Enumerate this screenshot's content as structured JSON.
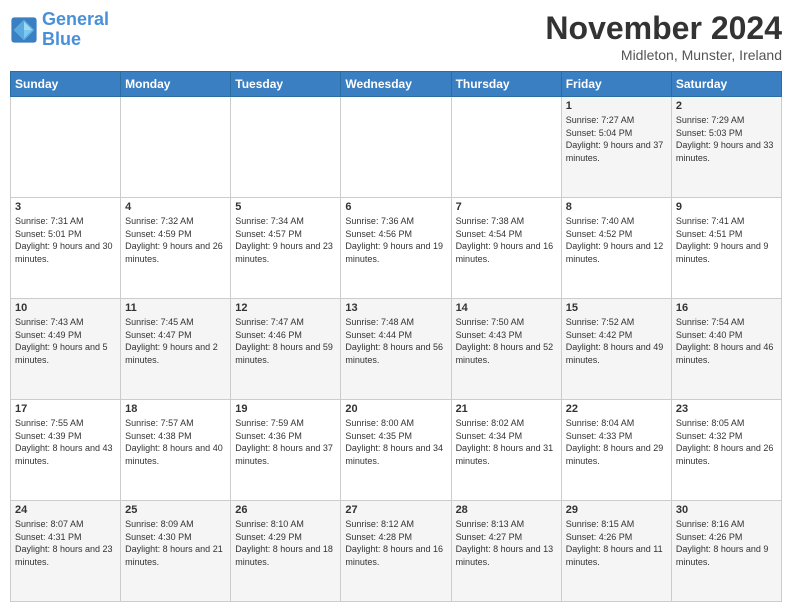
{
  "logo": {
    "line1": "General",
    "line2": "Blue"
  },
  "title": "November 2024",
  "location": "Midleton, Munster, Ireland",
  "days_of_week": [
    "Sunday",
    "Monday",
    "Tuesday",
    "Wednesday",
    "Thursday",
    "Friday",
    "Saturday"
  ],
  "weeks": [
    [
      {
        "day": "",
        "info": ""
      },
      {
        "day": "",
        "info": ""
      },
      {
        "day": "",
        "info": ""
      },
      {
        "day": "",
        "info": ""
      },
      {
        "day": "",
        "info": ""
      },
      {
        "day": "1",
        "info": "Sunrise: 7:27 AM\nSunset: 5:04 PM\nDaylight: 9 hours and 37 minutes."
      },
      {
        "day": "2",
        "info": "Sunrise: 7:29 AM\nSunset: 5:03 PM\nDaylight: 9 hours and 33 minutes."
      }
    ],
    [
      {
        "day": "3",
        "info": "Sunrise: 7:31 AM\nSunset: 5:01 PM\nDaylight: 9 hours and 30 minutes."
      },
      {
        "day": "4",
        "info": "Sunrise: 7:32 AM\nSunset: 4:59 PM\nDaylight: 9 hours and 26 minutes."
      },
      {
        "day": "5",
        "info": "Sunrise: 7:34 AM\nSunset: 4:57 PM\nDaylight: 9 hours and 23 minutes."
      },
      {
        "day": "6",
        "info": "Sunrise: 7:36 AM\nSunset: 4:56 PM\nDaylight: 9 hours and 19 minutes."
      },
      {
        "day": "7",
        "info": "Sunrise: 7:38 AM\nSunset: 4:54 PM\nDaylight: 9 hours and 16 minutes."
      },
      {
        "day": "8",
        "info": "Sunrise: 7:40 AM\nSunset: 4:52 PM\nDaylight: 9 hours and 12 minutes."
      },
      {
        "day": "9",
        "info": "Sunrise: 7:41 AM\nSunset: 4:51 PM\nDaylight: 9 hours and 9 minutes."
      }
    ],
    [
      {
        "day": "10",
        "info": "Sunrise: 7:43 AM\nSunset: 4:49 PM\nDaylight: 9 hours and 5 minutes."
      },
      {
        "day": "11",
        "info": "Sunrise: 7:45 AM\nSunset: 4:47 PM\nDaylight: 9 hours and 2 minutes."
      },
      {
        "day": "12",
        "info": "Sunrise: 7:47 AM\nSunset: 4:46 PM\nDaylight: 8 hours and 59 minutes."
      },
      {
        "day": "13",
        "info": "Sunrise: 7:48 AM\nSunset: 4:44 PM\nDaylight: 8 hours and 56 minutes."
      },
      {
        "day": "14",
        "info": "Sunrise: 7:50 AM\nSunset: 4:43 PM\nDaylight: 8 hours and 52 minutes."
      },
      {
        "day": "15",
        "info": "Sunrise: 7:52 AM\nSunset: 4:42 PM\nDaylight: 8 hours and 49 minutes."
      },
      {
        "day": "16",
        "info": "Sunrise: 7:54 AM\nSunset: 4:40 PM\nDaylight: 8 hours and 46 minutes."
      }
    ],
    [
      {
        "day": "17",
        "info": "Sunrise: 7:55 AM\nSunset: 4:39 PM\nDaylight: 8 hours and 43 minutes."
      },
      {
        "day": "18",
        "info": "Sunrise: 7:57 AM\nSunset: 4:38 PM\nDaylight: 8 hours and 40 minutes."
      },
      {
        "day": "19",
        "info": "Sunrise: 7:59 AM\nSunset: 4:36 PM\nDaylight: 8 hours and 37 minutes."
      },
      {
        "day": "20",
        "info": "Sunrise: 8:00 AM\nSunset: 4:35 PM\nDaylight: 8 hours and 34 minutes."
      },
      {
        "day": "21",
        "info": "Sunrise: 8:02 AM\nSunset: 4:34 PM\nDaylight: 8 hours and 31 minutes."
      },
      {
        "day": "22",
        "info": "Sunrise: 8:04 AM\nSunset: 4:33 PM\nDaylight: 8 hours and 29 minutes."
      },
      {
        "day": "23",
        "info": "Sunrise: 8:05 AM\nSunset: 4:32 PM\nDaylight: 8 hours and 26 minutes."
      }
    ],
    [
      {
        "day": "24",
        "info": "Sunrise: 8:07 AM\nSunset: 4:31 PM\nDaylight: 8 hours and 23 minutes."
      },
      {
        "day": "25",
        "info": "Sunrise: 8:09 AM\nSunset: 4:30 PM\nDaylight: 8 hours and 21 minutes."
      },
      {
        "day": "26",
        "info": "Sunrise: 8:10 AM\nSunset: 4:29 PM\nDaylight: 8 hours and 18 minutes."
      },
      {
        "day": "27",
        "info": "Sunrise: 8:12 AM\nSunset: 4:28 PM\nDaylight: 8 hours and 16 minutes."
      },
      {
        "day": "28",
        "info": "Sunrise: 8:13 AM\nSunset: 4:27 PM\nDaylight: 8 hours and 13 minutes."
      },
      {
        "day": "29",
        "info": "Sunrise: 8:15 AM\nSunset: 4:26 PM\nDaylight: 8 hours and 11 minutes."
      },
      {
        "day": "30",
        "info": "Sunrise: 8:16 AM\nSunset: 4:26 PM\nDaylight: 8 hours and 9 minutes."
      }
    ]
  ]
}
